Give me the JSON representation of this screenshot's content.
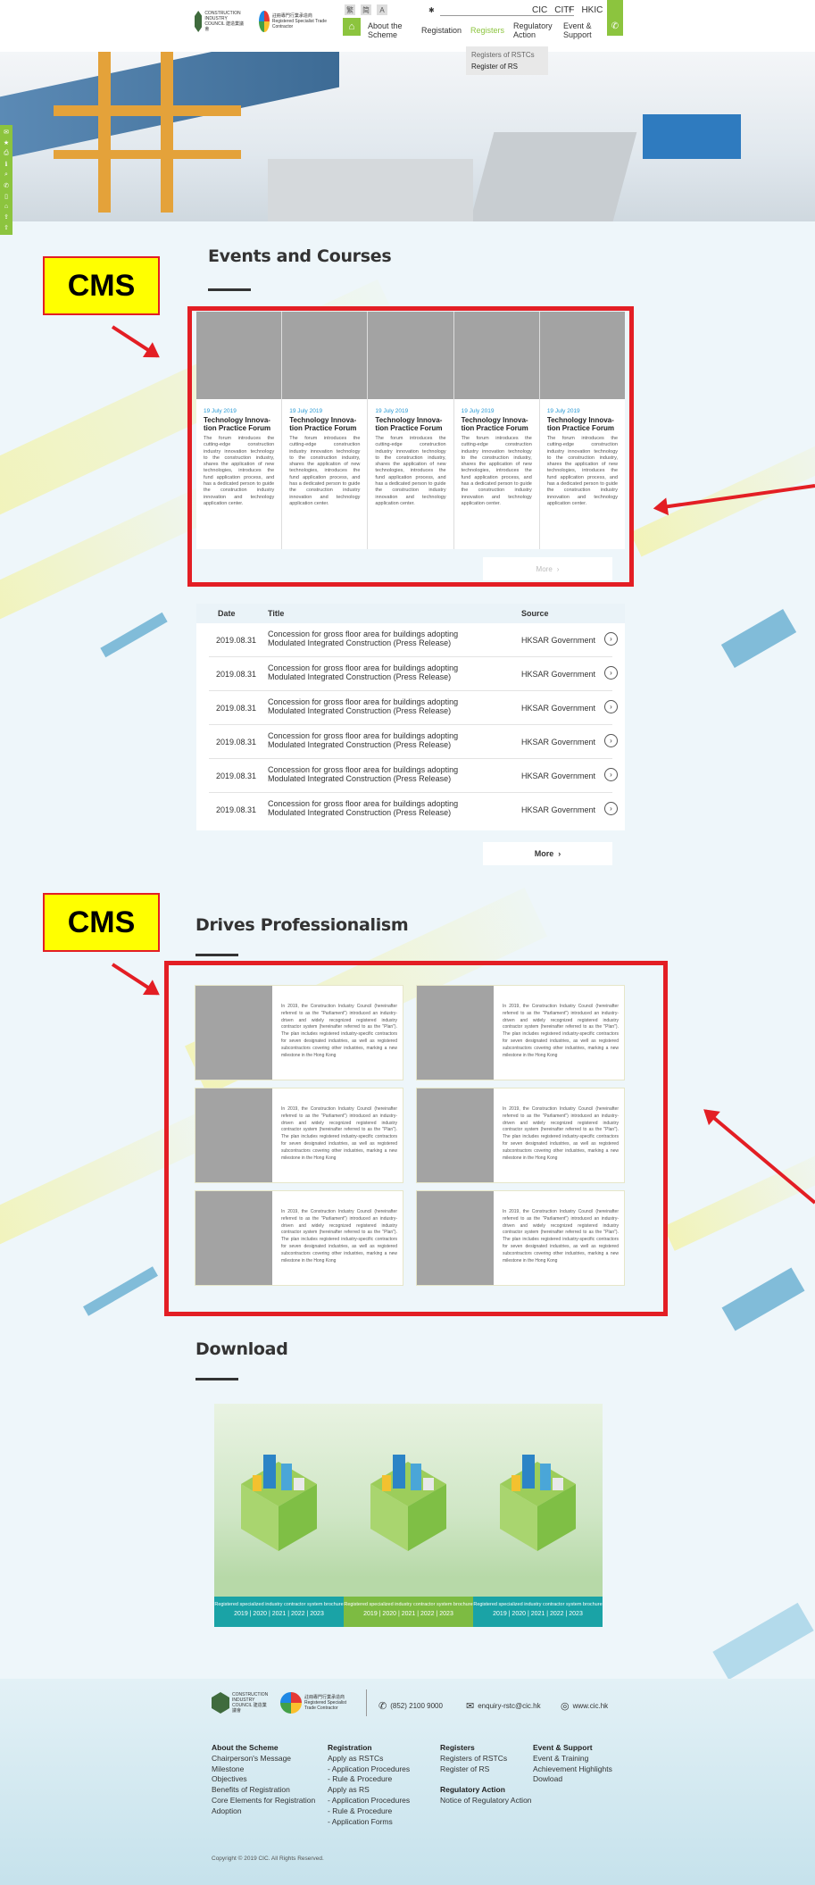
{
  "header": {
    "logo_cic_text": "CONSTRUCTION INDUSTRY COUNCIL 建造業議會",
    "logo_rstc_text": "註冊專門行業承造商 Registered Specialist Trade Contractor",
    "util": [
      "繁",
      "简",
      "A"
    ],
    "sites": [
      "CIC",
      "CITF",
      "HKIC"
    ],
    "nav": [
      "About the Scheme",
      "Registation",
      "Registers",
      "Regulatory Action",
      "Event & Support"
    ],
    "dropdown": [
      "Registers of RSTCs",
      "Register of RS"
    ]
  },
  "annotations": {
    "cms_label": "CMS"
  },
  "events": {
    "title": "Events and Courses",
    "cards": [
      {
        "date": "19 July 2019",
        "title": "Technology Innova-tion Practice Forum",
        "desc": "The forum introduces the cutting-edge construction industry innovation technology to the construction industry, shares the application of new technologies, introduces the fund application process, and has a dedicated person to guide the construction industry innovation and technology application center."
      },
      {
        "date": "19 July 2019",
        "title": "Technology Innova-tion Practice Forum",
        "desc": "The forum introduces the cutting-edge construction industry innovation technology to the construction industry, shares the application of new technologies, introduces the fund application process, and has a dedicated person to guide the construction industry innovation and technology application center."
      },
      {
        "date": "19 July 2019",
        "title": "Technology Innova-tion Practice Forum",
        "desc": "The forum introduces the cutting-edge construction industry innovation technology to the construction industry, shares the application of new technologies, introduces the fund application process, and has a dedicated person to guide the construction industry innovation and technology application center."
      },
      {
        "date": "19 July 2019",
        "title": "Technology Innova-tion Practice Forum",
        "desc": "The forum introduces the cutting-edge construction industry innovation technology to the construction industry, shares the application of new technologies, introduces the fund application process, and has a dedicated person to guide the construction industry innovation and technology application center."
      },
      {
        "date": "19 July 2019",
        "title": "Technology Innova-tion Practice Forum",
        "desc": "The forum introduces the cutting-edge construction industry innovation technology to the construction industry, shares the application of new technologies, introduces the fund application process, and has a dedicated person to guide the construction industry innovation and technology application center."
      }
    ],
    "more_label": "More"
  },
  "news": {
    "headers": {
      "date": "Date",
      "title": "Title",
      "source": "Source"
    },
    "rows": [
      {
        "date": "2019.08.31",
        "title": "Concession for gross floor area for buildings adopting Modulated Integrated Construction (Press Release)",
        "source": "HKSAR Government"
      },
      {
        "date": "2019.08.31",
        "title": "Concession for gross floor area for buildings adopting Modulated Integrated Construction (Press Release)",
        "source": "HKSAR Government"
      },
      {
        "date": "2019.08.31",
        "title": "Concession for gross floor area for buildings adopting Modulated Integrated Construction (Press Release)",
        "source": "HKSAR Government"
      },
      {
        "date": "2019.08.31",
        "title": "Concession for gross floor area for buildings adopting Modulated Integrated Construction (Press Release)",
        "source": "HKSAR Government"
      },
      {
        "date": "2019.08.31",
        "title": "Concession for gross floor area for buildings adopting Modulated Integrated Construction (Press Release)",
        "source": "HKSAR Government"
      },
      {
        "date": "2019.08.31",
        "title": "Concession for gross floor area for buildings adopting Modulated Integrated Construction (Press Release)",
        "source": "HKSAR Government"
      }
    ],
    "more_label": "More"
  },
  "professionalism": {
    "title": "Drives Professionalism",
    "paragraph": "In 2019, the Construction Industry Council (hereinafter referred to as the \"Parliament\") introduced an industry-driven and widely recognized registered industry contractor system (hereinafter referred to as the \"Plan\"). The plan includes registered industry-specific contractors for seven designated industries, as well as registered subcontractors covering other industries, marking a new milestone in the Hong Kong"
  },
  "download": {
    "title": "Download",
    "brochure_title": "Registered specialized industry contractor system brochure",
    "years": "2019 | 2020 | 2021 | 2022 | 2023",
    "band_colors": [
      "#1aa3a6",
      "#7dbb42",
      "#1aa3a6"
    ]
  },
  "footer": {
    "phone": "(852) 2100 9000",
    "email": "enquiry-rstc@cic.hk",
    "web": "www.cic.hk",
    "col1": {
      "head": "About the Scheme",
      "items": [
        "Chairperson's Message",
        "Milestone",
        "Objectives",
        "Benefits of Registration",
        "Core Elements for Registration",
        "Adoption"
      ]
    },
    "col2": {
      "head": "Registration",
      "items": [
        "Apply as RSTCs",
        "- Application Procedures",
        "- Rule & Procedure",
        "Apply as RS",
        "- Application Procedures",
        "- Rule & Procedure",
        "- Application Forms"
      ]
    },
    "col3": {
      "head": "Registers",
      "items": [
        "Registers of RSTCs",
        "Register of RS"
      ],
      "head2": "Regulatory Action",
      "items2": [
        "Notice of Regulatory Action"
      ]
    },
    "col4": {
      "head": "Event & Support",
      "items": [
        "Event & Training",
        "Achievement Highlights",
        "Dowload"
      ]
    },
    "copyright": "Copyright © 2019 CIC. All Rights Reserved."
  },
  "colors": {
    "accent": "#8cc43e",
    "annotation_red": "#e31e24",
    "annotation_yellow": "#ffff00",
    "link_blue": "#2a9ad4"
  }
}
